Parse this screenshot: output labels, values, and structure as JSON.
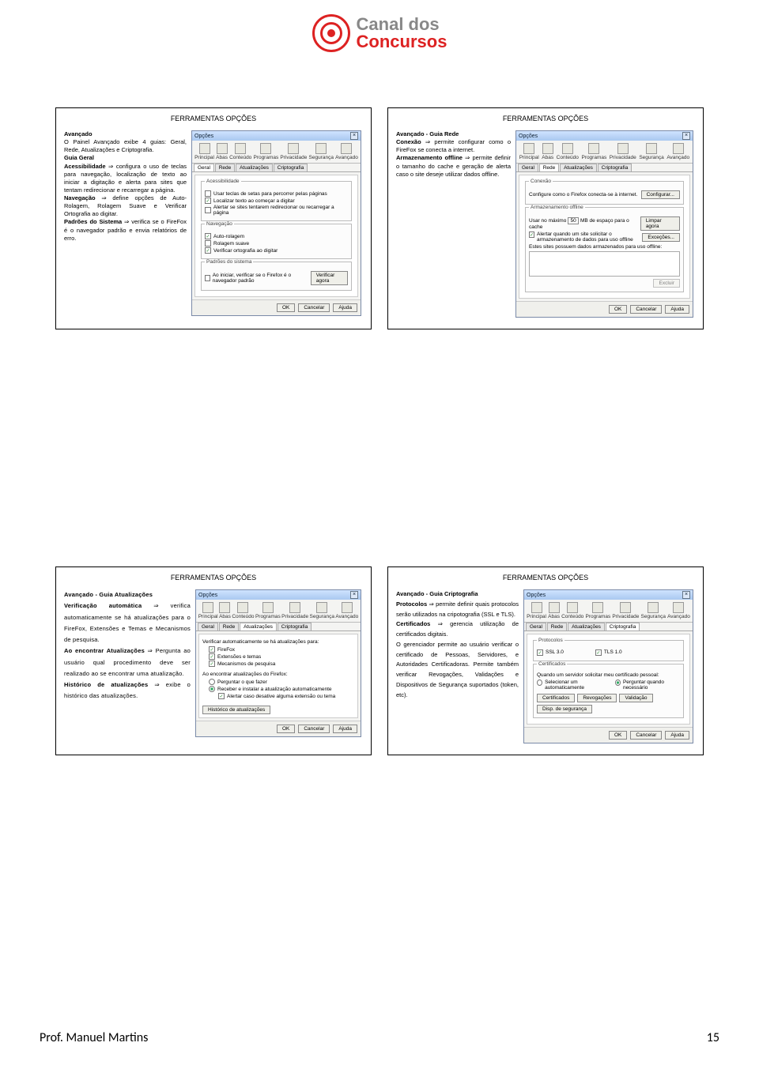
{
  "brand": {
    "line1": "Canal dos",
    "line2": "Concursos"
  },
  "slides_title": "FERRAMENTAS OPÇÕES",
  "win": {
    "title": "Opções",
    "close": "×",
    "toolbar": [
      "Principal",
      "Abas",
      "Conteúdo",
      "Programas",
      "Privacidade",
      "Segurança",
      "Avançado"
    ],
    "ok": "OK",
    "cancel": "Cancelar",
    "help": "Ajuda"
  },
  "tabs": {
    "geral": "Geral",
    "rede": "Rede",
    "atual": "Atualizações",
    "cript": "Criptografia"
  },
  "slide1": {
    "h": "Avançado",
    "p1": "O Painel Avançado exibe 4 guias: Geral, Rede, Atualizações e Criptografia.",
    "g1": "Guia Geral",
    "g2a": "Acessibilidade",
    "g2b": " ⇒ configura o uso de teclas para navegação, localização de texto ao iniciar a digitação e alerta para sites que tentam redirecionar e recarregar a página.",
    "g3a": "Navegação",
    "g3b": " ⇒ define opções de Auto-Rolagem, Rolagem Suave e Verificar Ortografia ao digitar.",
    "g4a": "Padrões do Sistema",
    "g4b": " ⇒ verifica se o FireFox é o navegador padrão e envia relatórios de erro.",
    "fs": {
      "acess": "Acessibilidade",
      "a1": "Usar teclas de setas para percorrer pelas páginas",
      "a2": "Localizar texto ao começar a digitar",
      "a3": "Alertar se sites tentarem redirecionar ou recarregar a página",
      "nav": "Navegação",
      "n1": "Auto-rolagem",
      "n2": "Rolagem suave",
      "n3": "Verificar ortografia ao digitar",
      "sys": "Padrões do sistema",
      "s1": "Ao iniciar, verificar se o Firefox é o navegador padrão",
      "vbtn": "Verificar agora"
    }
  },
  "slide2": {
    "h": "Avançado - Guia Rede",
    "p1a": "Conexão",
    "p1b": " ⇒ permite configurar como o FireFox se conecta a internet.",
    "p2a": "Armazenamento offline",
    "p2b": " ⇒ permite definir o tamanho do cache e geração de alerta caso o site deseje utilizar dados offline.",
    "fs": {
      "con": "Conexão",
      "con_txt": "Configure como o Firefox conecta-se à internet.",
      "cfg": "Configurar...",
      "off": "Armazenamento offline",
      "row": "Usar no máximo",
      "val": "50",
      "unit": "MB de espaço para o cache",
      "clear": "Limpar agora",
      "alert": "Alertar quando um site solicitar o armazenamento de dados para uso offline",
      "exc": "Exceções...",
      "list": "Estes sites possuem dados armazenados para uso offline:",
      "rem": "Excluir"
    }
  },
  "slide3": {
    "h": "Avançado - Guia Atualizações",
    "p1a": "Verificação automática",
    "p1b": " ⇒ verifica automaticamente se há atualizações para o FireFox, Extensões e Temas e Mecanismos de pesquisa.",
    "p2a": "Ao encontrar Atualizações",
    "p2b": " ⇒ Pergunta ao usuário qual procedimento deve ser realizado ao se encontrar uma atualização.",
    "p3a": "Histórico de atualizações",
    "p3b": " ⇒ exibe o histórico das atualizações.",
    "fs": {
      "auto": "Verificar automaticamente se há atualizações para:",
      "a1": "FireFox",
      "a2": "Extensões e temas",
      "a3": "Mecanismos de pesquisa",
      "found": "Ao encontrar atualizações do Firefox:",
      "f1": "Perguntar o que fazer",
      "f2": "Receber e instalar a atualização automaticamente",
      "f3": "Alertar caso desative alguma extensão ou tema",
      "hist": "Histórico de atualizações"
    }
  },
  "slide4": {
    "h": "Avançado - Guia Criptografia",
    "p1a": "Protocolos",
    "p1b": " ⇒ permite definir quais protocolos serão utilizados na cripotografia (SSL e TLS).",
    "p2a": "Certificados",
    "p2b": " ⇒ gerencia utilização de certificados digitais.",
    "p3": "O gerenciador permite ao usuário verificar o certificado de Pessoas, Servidores, e Autoridades Certificadoras. Permite também verificar Revogações, Validações e Dispositivos de Segurança suportados (token, etc).",
    "fs": {
      "prot": "Protocolos",
      "ssl": "SSL 3.0",
      "tls": "TLS 1.0",
      "cert": "Certificados",
      "q": "Quando um servidor solicitar meu certificado pessoal:",
      "r1": "Selecionar um automaticamente",
      "r2": "Perguntar quando necessário",
      "b1": "Certificados",
      "b2": "Revogações",
      "b3": "Validação",
      "b4": "Disp. de segurança"
    }
  },
  "footer": {
    "author": "Prof. Manuel Martins",
    "page": "15"
  }
}
